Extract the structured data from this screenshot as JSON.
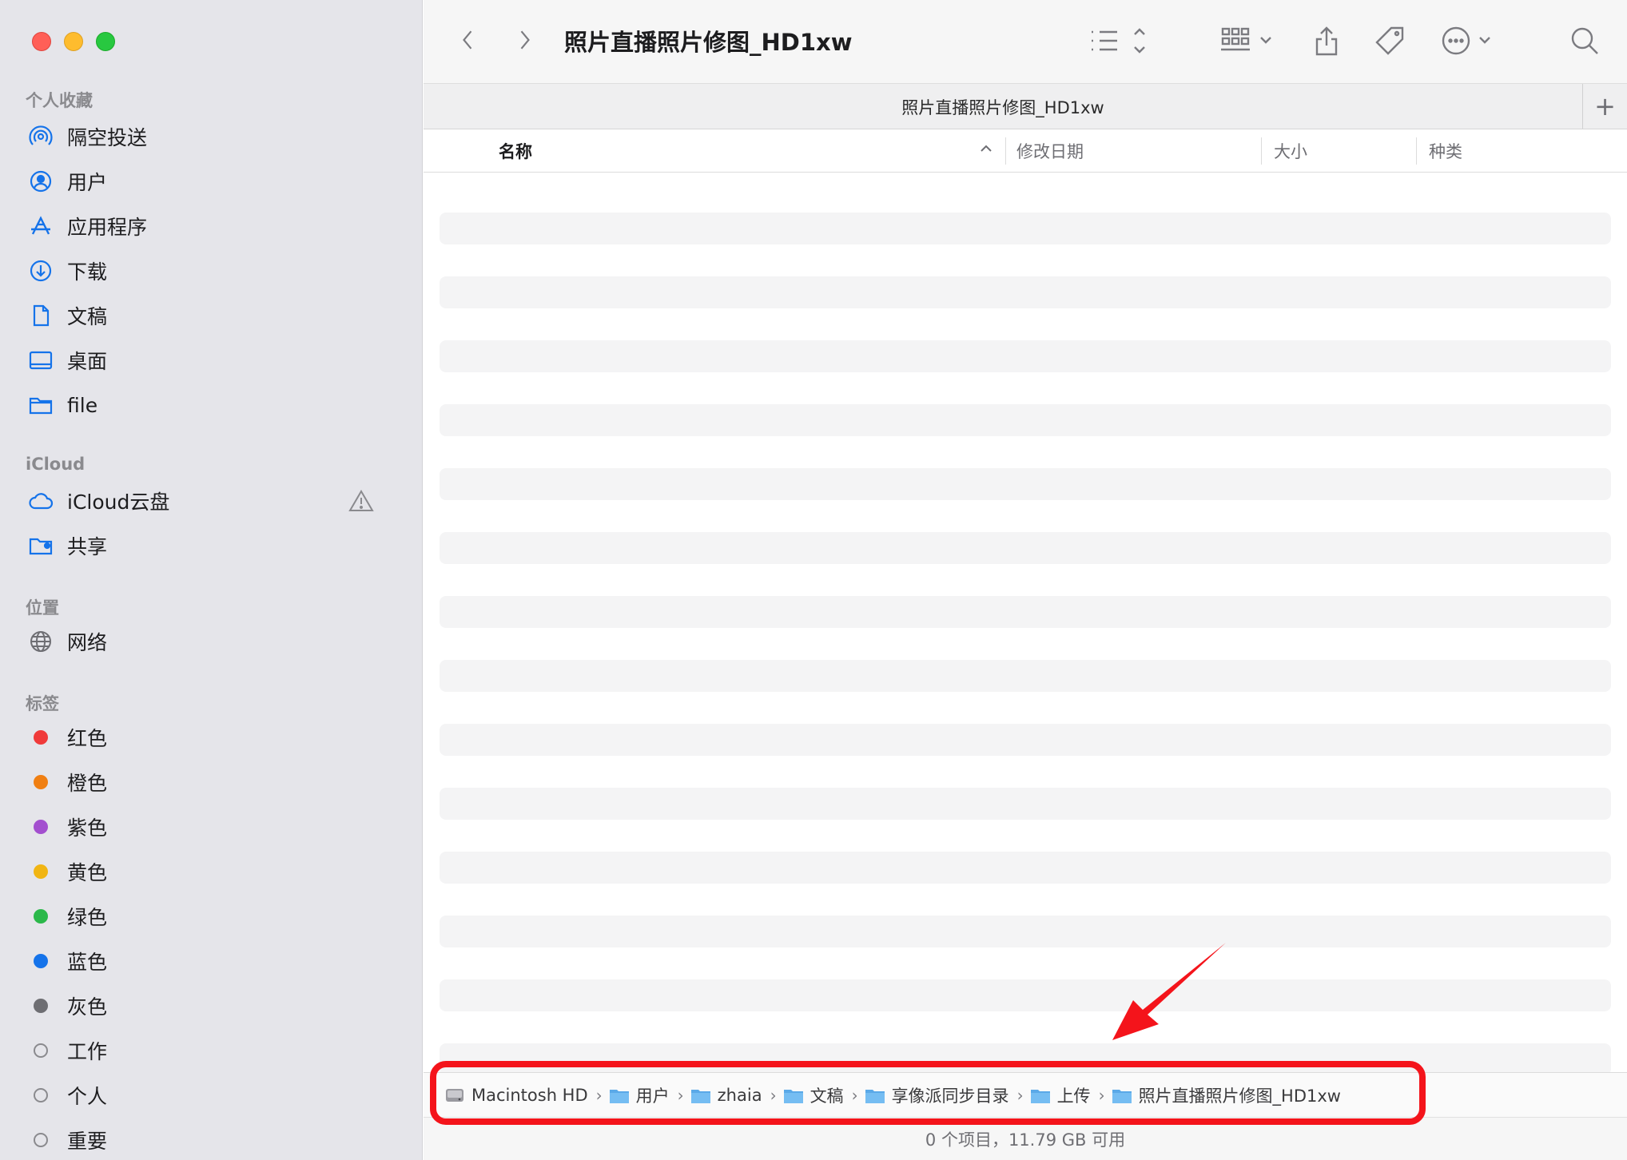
{
  "window": {
    "title": "照片直播照片修图_HD1xw"
  },
  "tab": {
    "title": "照片直播照片修图_HD1xw",
    "add": "+"
  },
  "sidebar": {
    "favorites_title": "个人收藏",
    "favorites": [
      {
        "label": "隔空投送",
        "icon": "airdrop-icon"
      },
      {
        "label": "用户",
        "icon": "user-circle-icon"
      },
      {
        "label": "应用程序",
        "icon": "applications-icon"
      },
      {
        "label": "下载",
        "icon": "download-icon"
      },
      {
        "label": "文稿",
        "icon": "document-icon"
      },
      {
        "label": "桌面",
        "icon": "desktop-icon"
      },
      {
        "label": "file",
        "icon": "folder-icon"
      }
    ],
    "icloud_title": "iCloud",
    "icloud": [
      {
        "label": "iCloud云盘",
        "icon": "cloud-icon"
      },
      {
        "label": "共享",
        "icon": "shared-folder-icon"
      }
    ],
    "locations_title": "位置",
    "locations": [
      {
        "label": "网络",
        "icon": "globe-icon"
      }
    ],
    "tags_title": "标签",
    "tags": [
      {
        "label": "红色",
        "color": "#f03a3a"
      },
      {
        "label": "橙色",
        "color": "#f07f12"
      },
      {
        "label": "紫色",
        "color": "#a34fcf"
      },
      {
        "label": "黄色",
        "color": "#f1b513"
      },
      {
        "label": "绿色",
        "color": "#2bb84a"
      },
      {
        "label": "蓝色",
        "color": "#1573ea"
      },
      {
        "label": "灰色",
        "color": "#6e6e73"
      },
      {
        "label": "工作",
        "color": ""
      },
      {
        "label": "个人",
        "color": ""
      },
      {
        "label": "重要",
        "color": ""
      }
    ]
  },
  "columns": {
    "name": "名称",
    "date": "修改日期",
    "size": "大小",
    "kind": "种类"
  },
  "path": [
    {
      "label": "Macintosh HD",
      "icon": "hard-drive-icon"
    },
    {
      "label": "用户",
      "icon": "folder-icon"
    },
    {
      "label": "zhaia",
      "icon": "home-folder-icon"
    },
    {
      "label": "文稿",
      "icon": "folder-icon"
    },
    {
      "label": "享像派同步目录",
      "icon": "folder-icon"
    },
    {
      "label": "上传",
      "icon": "folder-icon"
    },
    {
      "label": "照片直播照片修图_HD1xw",
      "icon": "folder-icon"
    }
  ],
  "path_separator": "›",
  "status": {
    "text": "0 个项目，11.79 GB 可用"
  },
  "accent": "#1573ea",
  "annotation_color": "#f4141b"
}
